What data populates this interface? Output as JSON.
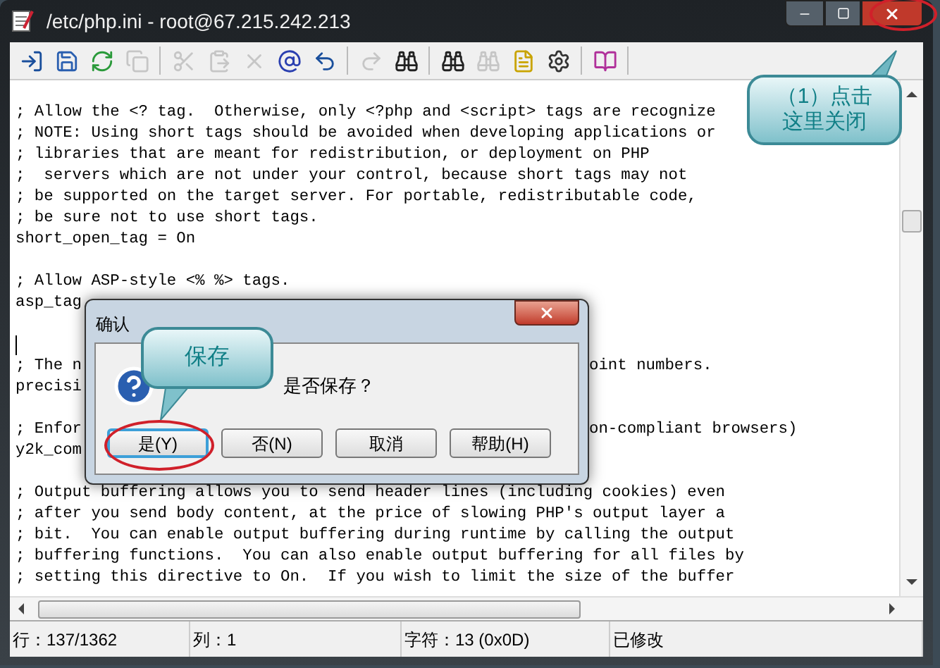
{
  "window": {
    "title": "/etc/php.ini - root@67.215.242.213"
  },
  "toolbar": [
    {
      "disabled": false
    },
    {
      "disabled": false
    },
    {
      "disabled": false
    },
    {
      "disabled": true
    },
    {
      "disabled": true
    },
    {
      "disabled": true
    },
    {
      "disabled": true
    },
    {
      "disabled": false
    },
    {
      "disabled": false
    },
    {
      "disabled": true
    },
    {
      "disabled": false
    },
    {
      "disabled": false
    },
    {
      "disabled": true
    },
    {
      "disabled": false
    },
    {
      "disabled": false
    },
    {
      "disabled": false
    }
  ],
  "editor": {
    "lines": [
      {
        "kind": "blank"
      },
      {
        "kind": "text",
        "text": "; Allow the <? tag.  Otherwise, only <?php and <script> tags are recognize"
      },
      {
        "kind": "text",
        "text": "; NOTE: Using short tags should be avoided when developing applications or"
      },
      {
        "kind": "text",
        "text": "; libraries that are meant for redistribution, or deployment on PHP"
      },
      {
        "kind": "text",
        "text": ";  servers which are not under your control, because short tags may not"
      },
      {
        "kind": "text",
        "text": "; be supported on the target server. For portable, redistributable code,"
      },
      {
        "kind": "text",
        "text": "; be sure not to use short tags."
      },
      {
        "kind": "text",
        "text": "short_open_tag = On"
      },
      {
        "kind": "blank"
      },
      {
        "kind": "text",
        "text": "; Allow ASP-style <% %> tags."
      },
      {
        "kind": "text",
        "text": "asp_tag"
      },
      {
        "kind": "blank"
      },
      {
        "kind": "cursor"
      },
      {
        "kind": "split",
        "text": "; The n",
        "after_dialog": "oint numbers."
      },
      {
        "kind": "text",
        "text": "precisi"
      },
      {
        "kind": "blank"
      },
      {
        "kind": "split",
        "text": "; Enfor",
        "after_dialog": "on-compliant browsers)"
      },
      {
        "kind": "text",
        "text": "y2k_com"
      },
      {
        "kind": "blank"
      },
      {
        "kind": "text",
        "text": "; Output buffering allows you to send header lines (including cookies) even"
      },
      {
        "kind": "text",
        "text": "; after you send body content, at the price of slowing PHP's output layer a"
      },
      {
        "kind": "text",
        "text": "; bit.  You can enable output buffering during runtime by calling the output"
      },
      {
        "kind": "text",
        "text": "; buffering functions.  You can also enable output buffering for all files by"
      },
      {
        "kind": "text",
        "text": "; setting this directive to On.  If you wish to limit the size of the buffer"
      }
    ]
  },
  "status_bar": [
    "行：137/1362",
    "列：1",
    "字符：13 (0x0D)",
    "已修改"
  ],
  "dialog": {
    "title": "确认",
    "message": "是否保存？",
    "buttons": [
      {
        "label": "是(Y)",
        "focused": true
      },
      {
        "label": "否(N)",
        "focused": false
      },
      {
        "label": "取消",
        "focused": false
      },
      {
        "label": "帮助(H)",
        "focused": false
      }
    ]
  },
  "annotations": [
    {
      "kind": "close",
      "lines": [
        "（1）点击",
        "这里关闭"
      ]
    },
    {
      "kind": "save",
      "lines": [
        "保存"
      ]
    }
  ]
}
